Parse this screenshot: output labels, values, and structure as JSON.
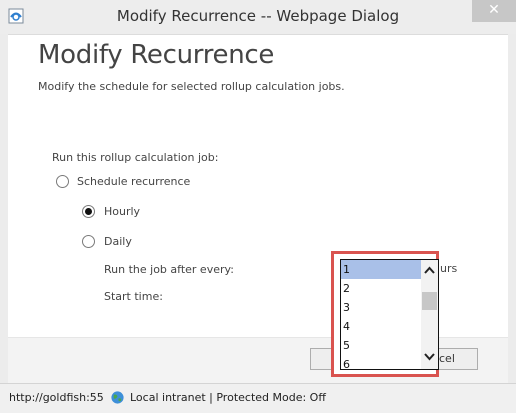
{
  "window": {
    "title": "Modify Recurrence -- Webpage Dialog",
    "close_glyph": "✕"
  },
  "page": {
    "heading": "Modify Recurrence",
    "subheading": "Modify the schedule for selected rollup calculation jobs."
  },
  "form": {
    "run_label": "Run this rollup calculation job:",
    "schedule_recurrence_label": "Schedule recurrence",
    "hourly_label": "Hourly",
    "daily_label": "Daily",
    "run_every_label": "Run the job after every:",
    "start_time_label": "Start time:",
    "hours_partial": "urs",
    "hourly_selected": true
  },
  "dropdown": {
    "options": [
      "1",
      "2",
      "3",
      "4",
      "5",
      "6"
    ],
    "selected_value": "1",
    "highlight_color": "#d9534f"
  },
  "footer": {
    "cancel_partial": "cel"
  },
  "statusbar": {
    "url": "http://goldfish:55",
    "zone": "Local intranet | Protected Mode: Off"
  },
  "icons": {
    "app_icon": "ie-icon",
    "close_icon": "close-icon",
    "zone_icon": "globe-icon",
    "scroll_up": "chevron-up-icon",
    "scroll_down": "chevron-down-icon"
  }
}
